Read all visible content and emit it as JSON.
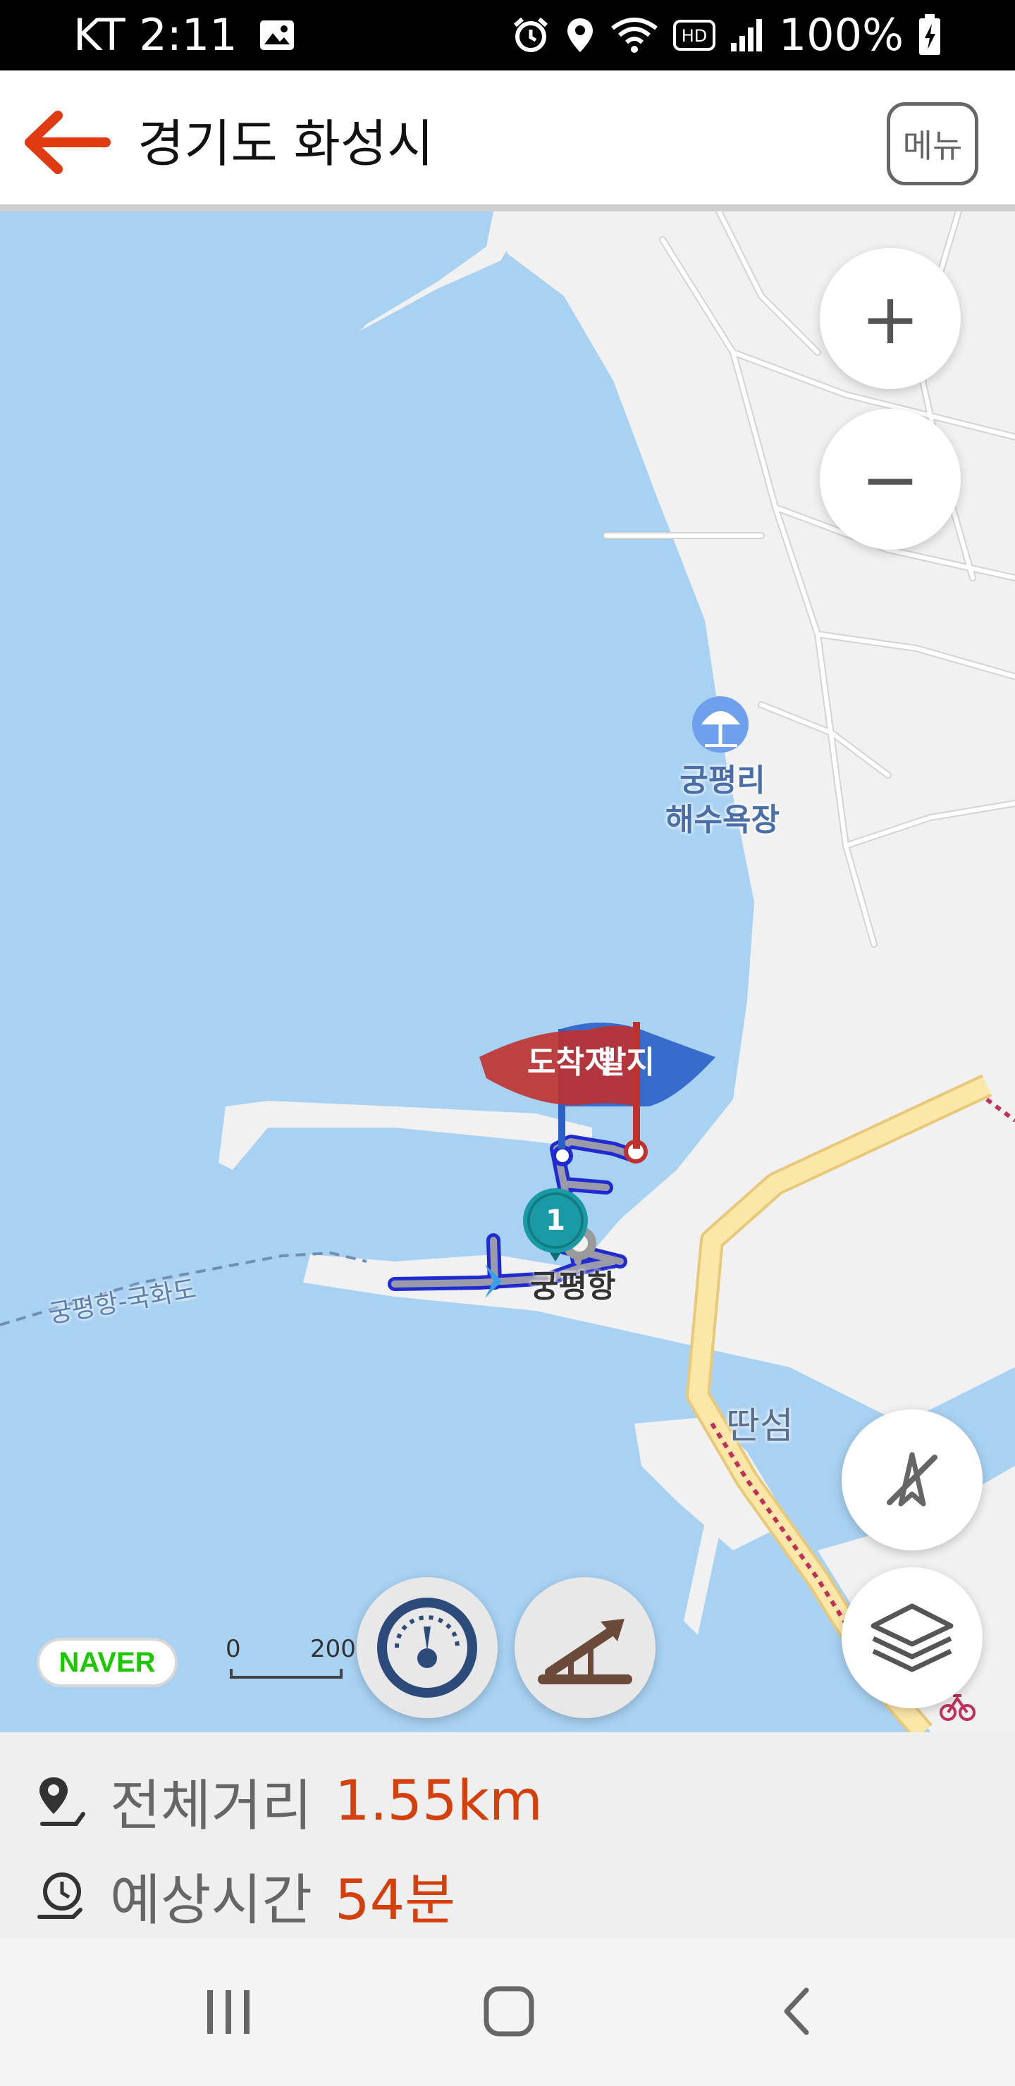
{
  "status_bar": {
    "carrier_time": "KT 2:11",
    "battery": "100%",
    "icons": [
      "image-icon",
      "alarm-icon",
      "location-icon",
      "wifi-icon",
      "hd-icon",
      "signal-icon",
      "battery-charging-icon"
    ]
  },
  "header": {
    "title": "경기도 화성시",
    "menu_label": "메뉴",
    "back_icon": "back-arrow-icon",
    "accent": "#e03a10"
  },
  "map": {
    "labels": {
      "beach": "궁평리\n해수욕장",
      "port": "궁평항",
      "ferry_route": "궁평항-국화도",
      "island": "딴섬",
      "arrival": "도착지",
      "departure_partial": "발지",
      "waypoint": "1"
    },
    "zoom_in": "+",
    "zoom_out": "−",
    "scale_zero": "0",
    "scale_end": "200",
    "brand": "NAVER",
    "colors": {
      "water": "#a8d1f2",
      "land": "#f1f1f1",
      "route": "#1f2bd0",
      "arrival_flag": "#c0312d",
      "departure_flag": "#2a5fc8",
      "waypoint": "#1a9aa5",
      "highway": "#fbe7a8"
    }
  },
  "info": {
    "distance_label": "전체거리",
    "distance_value": "1.55km",
    "time_label": "예상시간",
    "time_value": "54분"
  },
  "nav_bar": {
    "recent_icon": "recents-icon",
    "home_icon": "home-icon",
    "back_icon": "back-icon"
  }
}
